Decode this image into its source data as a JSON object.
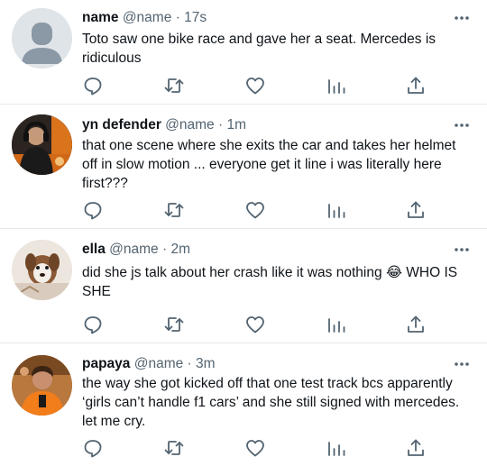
{
  "tweets": [
    {
      "name": "name",
      "handle": "@name",
      "time": "17s",
      "text": "Toto saw one bike race and gave her a seat. Mercedes is ridiculous",
      "avatar": "default-avatar"
    },
    {
      "name": "yn defender",
      "handle": "@name",
      "time": "1m",
      "text": "that one scene where she exits the car and takes her helmet off in slow motion ... everyone get it line i was literally here first???",
      "avatar": "photo-avatar-headphones"
    },
    {
      "name": "ella",
      "handle": "@name",
      "time": "2m",
      "text": "did she js talk about her crash like it was nothing 😂 WHO IS SHE",
      "avatar": "photo-avatar-dog"
    },
    {
      "name": "papaya",
      "handle": "@name",
      "time": "3m",
      "text": "the way she got kicked off that one test track bcs apparently ‘girls can’t handle f1 cars’ and she still signed with mercedes. let me cry.",
      "avatar": "photo-avatar-orange"
    }
  ],
  "separator": " · ",
  "icons": {
    "reply": "reply-icon",
    "retweet": "retweet-icon",
    "like": "heart-icon",
    "views": "views-icon",
    "share": "share-icon",
    "more": "more-icon"
  },
  "colors": {
    "text": "#0f1419",
    "secondary": "#536471",
    "icon": "#536471",
    "divider": "#e6e9eb"
  }
}
